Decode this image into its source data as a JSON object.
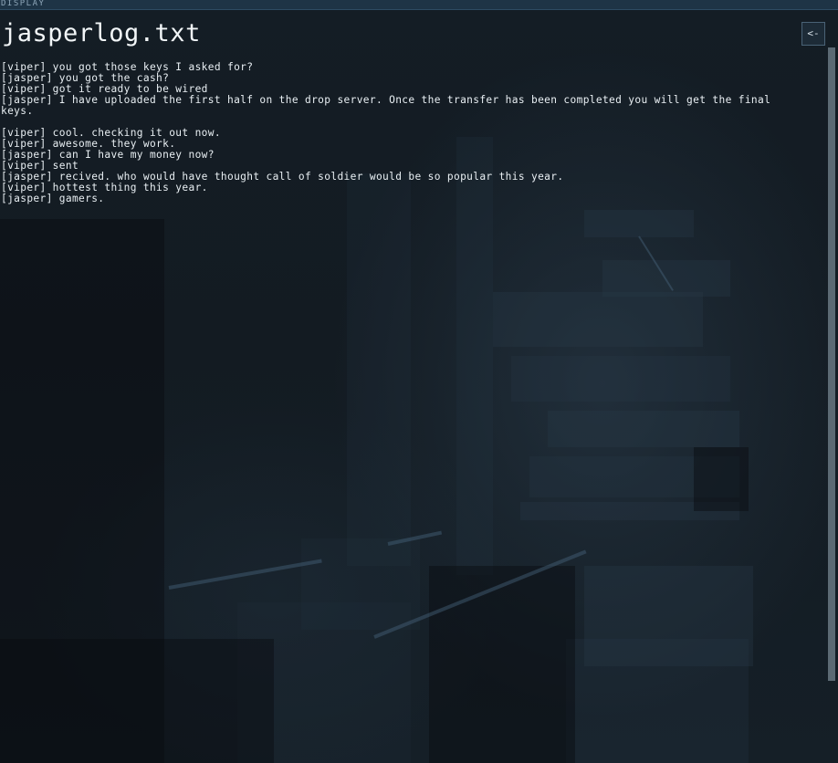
{
  "window": {
    "top_label": "DISPLAY"
  },
  "file": {
    "title": "jasperlog.txt",
    "back_button_label": "<-"
  },
  "log_lines": [
    "[viper] you got those keys I asked for?",
    "[jasper] you got the cash?",
    "[viper] got it ready to be wired",
    "[jasper] I have uploaded the first half on the drop server. Once the transfer has been completed you will get the final keys.",
    "",
    "[viper] cool. checking it out now.",
    "[viper] awesome. they work.",
    "[jasper] can I have my money now?",
    "[viper] sent",
    "[jasper] recived. who would have thought call of soldier would be so popular this year.",
    "[viper] hottest thing this year.",
    "[jasper] gamers."
  ]
}
